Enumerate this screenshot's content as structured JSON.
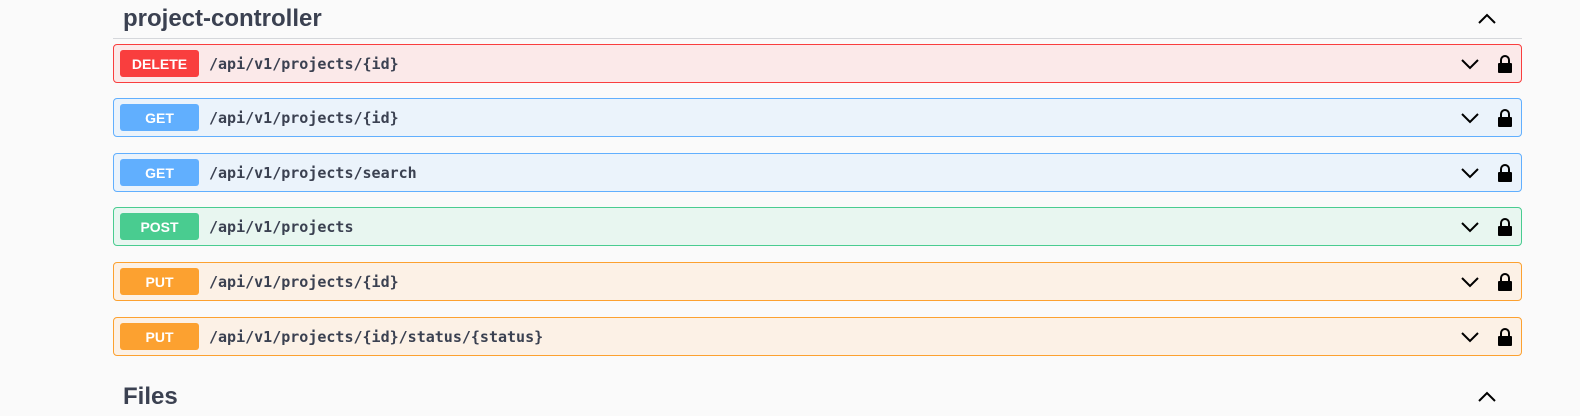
{
  "sections": {
    "project_controller": {
      "title": "project-controller"
    },
    "files": {
      "title": "Files"
    }
  },
  "operations": [
    {
      "method": "DELETE",
      "path": "/api/v1/projects/{id}"
    },
    {
      "method": "GET",
      "path": "/api/v1/projects/{id}"
    },
    {
      "method": "GET",
      "path": "/api/v1/projects/search"
    },
    {
      "method": "POST",
      "path": "/api/v1/projects"
    },
    {
      "method": "PUT",
      "path": "/api/v1/projects/{id}"
    },
    {
      "method": "PUT",
      "path": "/api/v1/projects/{id}/status/{status}"
    }
  ],
  "icons": {
    "collapse": "chevron-up-icon",
    "expand": "chevron-down-icon",
    "lock": "lock-icon"
  },
  "colors": {
    "delete": "#f93e3e",
    "get": "#61affe",
    "post": "#49cc90",
    "put": "#fca130",
    "text": "#3b4151"
  }
}
